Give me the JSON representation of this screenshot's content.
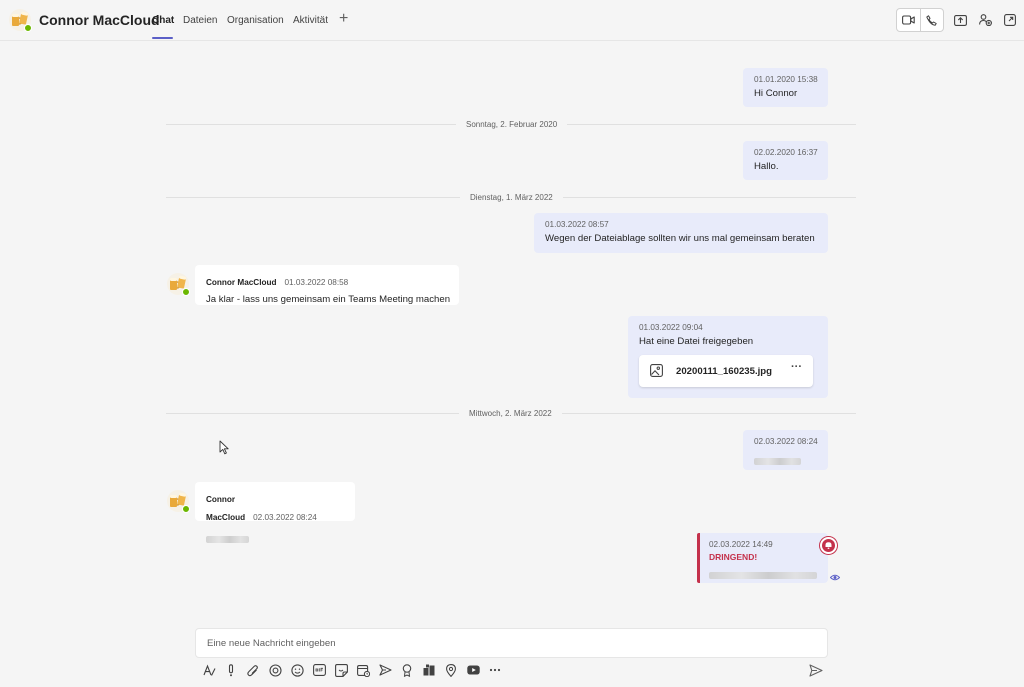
{
  "header": {
    "title": "Connor MacCloud",
    "tabs": [
      {
        "label": "Chat",
        "active": true
      },
      {
        "label": "Dateien",
        "active": false
      },
      {
        "label": "Organisation",
        "active": false
      },
      {
        "label": "Aktivität",
        "active": false
      }
    ],
    "add_tab_label": "+",
    "icons": [
      "video-call-icon",
      "audio-call-icon",
      "screen-share-icon",
      "add-people-icon",
      "popout-icon"
    ]
  },
  "colors": {
    "accent": "#5b5fc7",
    "my_bubble": "#e8ebfa",
    "urgent": "#c4314b",
    "presence": "#6bb700"
  },
  "messages": [
    {
      "type": "me",
      "timestamp": "01.01.2020 15:38",
      "text": "Hi Connor"
    },
    {
      "type": "divider",
      "label": "Sonntag, 2. Februar 2020"
    },
    {
      "type": "me",
      "timestamp": "02.02.2020 16:37",
      "text": "Hallo."
    },
    {
      "type": "divider",
      "label": "Dienstag, 1. März 2022"
    },
    {
      "type": "me",
      "timestamp": "01.03.2022 08:57",
      "text": "Wegen der Dateiablage sollten wir uns mal gemeinsam beraten"
    },
    {
      "type": "other",
      "sender": "Connor MacCloud",
      "timestamp": "01.03.2022 08:58",
      "text": "Ja klar - lass uns gemeinsam ein Teams Meeting machen"
    },
    {
      "type": "me",
      "timestamp": "01.03.2022 09:04",
      "text": "Hat eine Datei freigegeben",
      "attachment": {
        "filename": "20200111_160235.jpg",
        "more": "···"
      }
    },
    {
      "type": "divider",
      "label": "Mittwoch, 2. März 2022"
    },
    {
      "type": "me",
      "timestamp": "02.03.2022 08:24"
    },
    {
      "type": "other",
      "sender": "Connor MacCloud",
      "timestamp": "02.03.2022 08:24"
    },
    {
      "type": "me",
      "timestamp": "02.03.2022 14:49",
      "urgent_label": "DRINGEND!"
    }
  ],
  "compose": {
    "placeholder": "Eine neue Nachricht eingeben",
    "toolbar_icons": [
      "format-icon",
      "priority-icon",
      "attach-icon",
      "loop-icon",
      "emoji-icon",
      "gif-icon",
      "sticker-icon",
      "schedule-meeting-icon",
      "stream-icon",
      "praise-icon",
      "apps-icon",
      "location-icon",
      "youtube-icon",
      "more-icon"
    ]
  }
}
